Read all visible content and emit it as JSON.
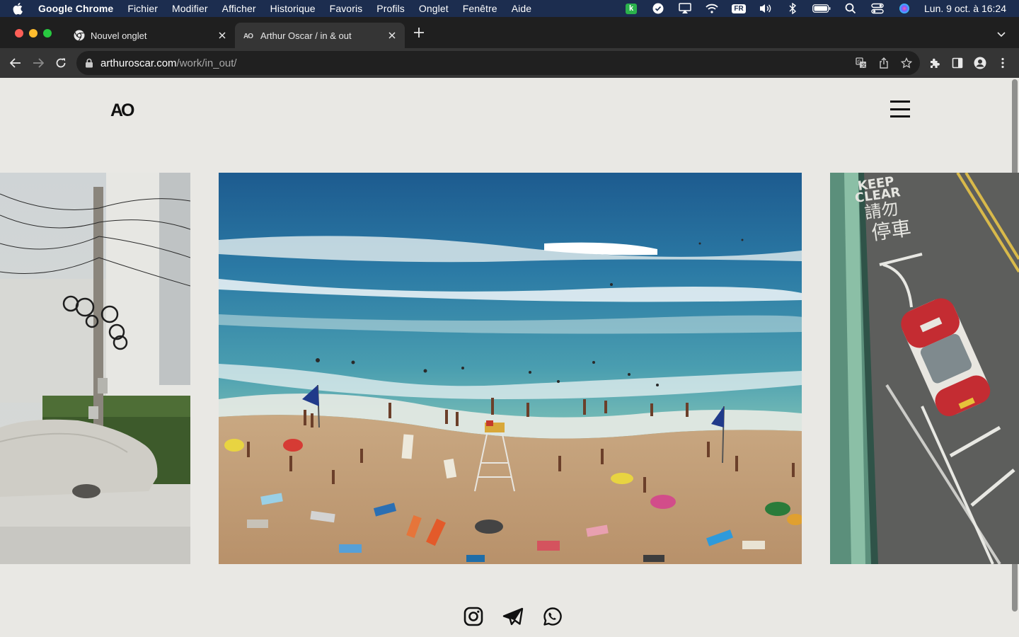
{
  "menubar": {
    "app_name": "Google Chrome",
    "items": [
      "Fichier",
      "Modifier",
      "Afficher",
      "Historique",
      "Favoris",
      "Profils",
      "Onglet",
      "Fenêtre",
      "Aide"
    ],
    "input_source": "FR",
    "clock": "Lun. 9 oct. à 16:24",
    "icons": [
      "apple-icon",
      "kaspersky-icon",
      "check-circle-icon",
      "airplay-icon",
      "wifi-icon",
      "volume-icon",
      "bluetooth-icon",
      "battery-icon",
      "spotlight-icon",
      "control-center-icon",
      "siri-icon"
    ]
  },
  "tabs": [
    {
      "title": "Nouvel onglet",
      "active": false
    },
    {
      "title": "Arthur Oscar / in & out",
      "active": true
    }
  ],
  "toolbar": {
    "url_host": "arthuroscar.com",
    "url_path": "/work/in_out/"
  },
  "site": {
    "logo": "AO",
    "photos": [
      "street-pole-photo",
      "beach-photo",
      "taxi-street-photo"
    ],
    "taxi_sign": {
      "line1": "KEEP",
      "line2": "CLEAR",
      "line3": "請勿",
      "line4": "停車"
    },
    "socials": [
      "instagram-icon",
      "telegram-icon",
      "whatsapp-icon"
    ]
  },
  "colors": {
    "menubar": "#1c2d4f",
    "tabstrip": "#1f1f1f",
    "toolbar": "#353535",
    "page_bg": "#e9e8e4"
  }
}
